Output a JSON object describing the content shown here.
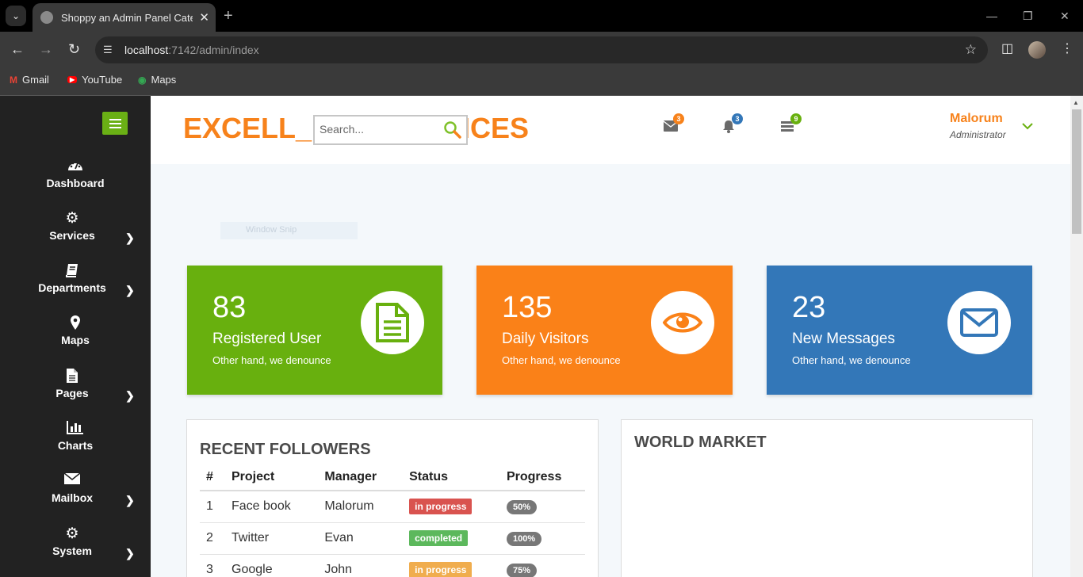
{
  "browser": {
    "tab_title": "Shoppy an Admin Panel Catego",
    "url_host": "localhost",
    "url_path": ":7142/admin/index",
    "bookmarks": [
      "Gmail",
      "YouTube",
      "Maps"
    ]
  },
  "sidebar": {
    "items": [
      {
        "label": "Dashboard",
        "icon": "dashboard-icon"
      },
      {
        "label": "Services",
        "icon": "cogs-icon"
      },
      {
        "label": "Departments",
        "icon": "book-icon"
      },
      {
        "label": "Maps",
        "icon": "map-marker-icon"
      },
      {
        "label": "Pages",
        "icon": "file-icon"
      },
      {
        "label": "Charts",
        "icon": "bar-chart-icon"
      },
      {
        "label": "Mailbox",
        "icon": "envelope-icon"
      },
      {
        "label": "System",
        "icon": "gear-icon"
      }
    ]
  },
  "header": {
    "logo_left": "EXCELL_",
    "logo_right": "/ICES",
    "search_placeholder": "Search...",
    "mail_count": "3",
    "bell_count": "3",
    "tasks_count": "9",
    "user_name": "Malorum",
    "user_role": "Administrator"
  },
  "overlay": {
    "snip_label": "Window Snip"
  },
  "cards": [
    {
      "value": "83",
      "label": "Registered User",
      "sub": "Other hand, we denounce",
      "color": "#68b00e"
    },
    {
      "value": "135",
      "label": "Daily Visitors",
      "sub": "Other hand, we denounce",
      "color": "#fa8118"
    },
    {
      "value": "23",
      "label": "New Messages",
      "sub": "Other hand, we denounce",
      "color": "#3377b8"
    }
  ],
  "followers": {
    "title": "RECENT FOLLOWERS",
    "columns": [
      "#",
      "Project",
      "Manager",
      "Status",
      "Progress"
    ],
    "rows": [
      {
        "num": "1",
        "project": "Face book",
        "manager": "Malorum",
        "status": "in progress",
        "status_color": "#d9534f",
        "progress": "50%"
      },
      {
        "num": "2",
        "project": "Twitter",
        "manager": "Evan",
        "status": "completed",
        "status_color": "#5cb85c",
        "progress": "100%"
      },
      {
        "num": "3",
        "project": "Google",
        "manager": "John",
        "status": "in progress",
        "status_color": "#f0ad4e",
        "progress": "75%"
      }
    ]
  },
  "world_market": {
    "title": "WORLD MARKET"
  },
  "colors": {
    "accent_orange": "#f7821b",
    "accent_green": "#6ab015",
    "sidebar_bg": "#222222"
  }
}
